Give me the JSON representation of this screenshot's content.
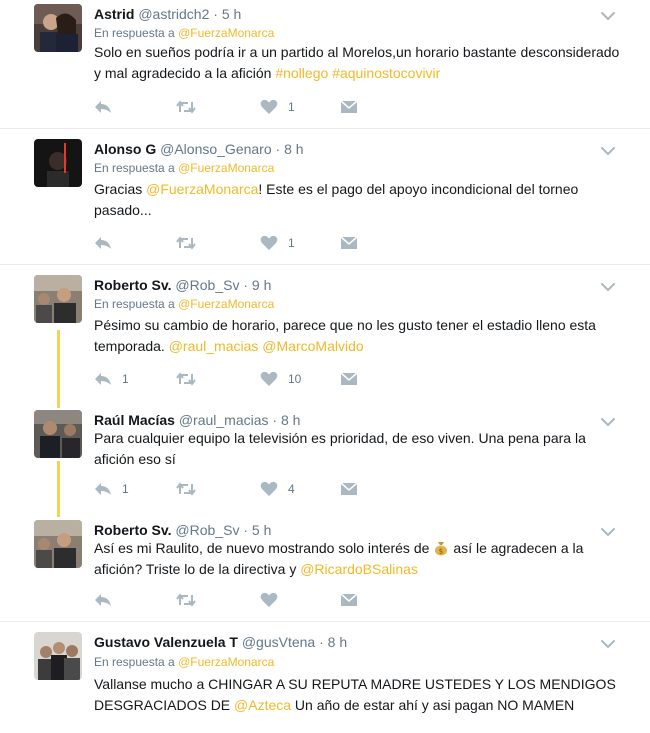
{
  "tweets": [
    {
      "name": "Astrid",
      "handle": "@astridch2",
      "time": "5 h",
      "reply_prefix": "En respuesta a",
      "reply_to": "@FuerzaMonarca",
      "text_a": "Solo en sueños podría ir a un partido al Morelos,un horario bastante desconsiderado y mal agradecido a la afición ",
      "link_a": "#nollego",
      "link_b": "#aquinostocovivir",
      "replies": "",
      "retweets": "",
      "likes": "1"
    },
    {
      "name": "Alonso G",
      "handle": "@Alonso_Genaro",
      "time": "8 h",
      "reply_prefix": "En respuesta a",
      "reply_to": "@FuerzaMonarca",
      "text_a": "Gracias ",
      "link_a": "@FuerzaMonarca",
      "text_b": "! Este es el pago del apoyo incondicional del torneo pasado...",
      "replies": "",
      "retweets": "",
      "likes": "1"
    },
    {
      "name": "Roberto Sv.",
      "handle": "@Rob_Sv",
      "time": "9 h",
      "reply_prefix": "En respuesta a",
      "reply_to": "@FuerzaMonarca",
      "text_a": "Pésimo su cambio de horario, parece que no les gusto tener el estadio lleno esta temporada. ",
      "link_a": "@raul_macias",
      "link_b": "@MarcoMalvido",
      "replies": "1",
      "retweets": "",
      "likes": "10"
    },
    {
      "name": "Raúl Macías",
      "handle": "@raul_macias",
      "time": "8 h",
      "text_a": "Para cualquier equipo la televisión es prioridad, de eso viven. Una pena para la afición eso sí",
      "replies": "1",
      "retweets": "",
      "likes": "4"
    },
    {
      "name": "Roberto Sv.",
      "handle": "@Rob_Sv",
      "time": "5 h",
      "text_a": "Así es mi Raulito, de nuevo mostrando solo interés de",
      "text_b": "así le agradecen a la afición? Triste lo de la directiva y ",
      "link_a": "@RicardoBSalinas",
      "emoji": "money-bag-emoji",
      "replies": "",
      "retweets": "",
      "likes": ""
    },
    {
      "name": "Gustavo Valenzuela T",
      "handle": "@gusVtena",
      "time": "8 h",
      "reply_prefix": "En respuesta a",
      "reply_to": "@FuerzaMonarca",
      "text_a": "Vallanse mucho a CHINGAR A SU REPUTA MADRE USTEDES Y LOS MENDIGOS DESGRACIADOS DE ",
      "link_a": "@Azteca",
      "text_b": " Un año de estar ahí y asi pagan NO MAMEN"
    }
  ],
  "colors": {
    "link": "#f1b928",
    "thread_line": "#f5d35a",
    "muted": "#657786",
    "icon": "#aab8c2",
    "separator": "#e6ecf0"
  },
  "icons": [
    "reply-icon",
    "retweet-icon",
    "like-icon",
    "direct-message-icon",
    "caret-down-icon"
  ]
}
